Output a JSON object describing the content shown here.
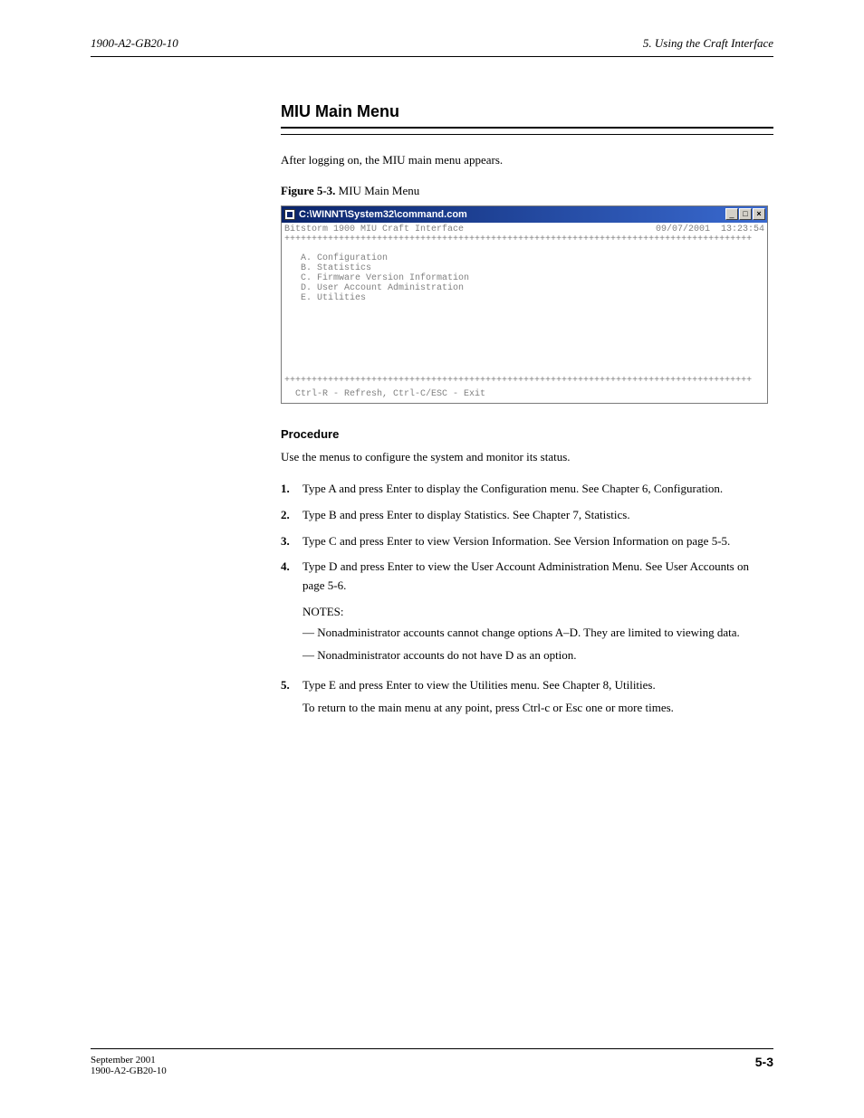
{
  "header": {
    "left": "1900-A2-GB20-10",
    "right": "5. Using the Craft Interface"
  },
  "section": {
    "title": "MIU Main Menu"
  },
  "intro": "After logging on, the MIU main menu appears.",
  "figure": {
    "label": "Figure 5-3.",
    "caption": "MIU Main Menu"
  },
  "console": {
    "window_title": "C:\\WINNT\\System32\\command.com",
    "header_left": "Bitstorm 1900 MIU Craft Interface",
    "header_date": "09/07/2001",
    "header_time": "13:23:54",
    "plus_line": "++++++++++++++++++++++++++++++++++++++++++++++++++++++++++++++++++++++++++++++++++++++",
    "menu": [
      "A. Configuration",
      "B. Statistics",
      "C. Firmware Version Information",
      "D. User Account Administration",
      "E. Utilities"
    ],
    "footer_hint": "Ctrl-R - Refresh, Ctrl-C/ESC - Exit",
    "buttons": {
      "min": "_",
      "max": "□",
      "close": "×"
    }
  },
  "procedure": {
    "title": "Procedure",
    "intro": "Use the menus to configure the system and monitor its status.",
    "steps": [
      "Type A and press Enter to display the Configuration menu. See Chapter 6, Configuration.",
      "Type B and press Enter to display Statistics. See Chapter 7, Statistics.",
      "Type C and press Enter to view Version Information. See Version Information on page 5-5.",
      "Type D and press Enter to view the User Account Administration Menu. See User Accounts on page 5-6."
    ],
    "notes_lead": "NOTES:",
    "notes": [
      "Nonadministrator accounts cannot change options A–D. They are limited to viewing data.",
      "Nonadministrator accounts do not have D as an option."
    ],
    "step5": "Type E and press Enter to view the Utilities menu. See Chapter 8, Utilities.",
    "step5_sub": "To return to the main menu at any point, press Ctrl-c or Esc one or more times."
  },
  "footer": {
    "date": "September 2001",
    "doc": "1900-A2-GB20-10",
    "page": "5-3"
  }
}
